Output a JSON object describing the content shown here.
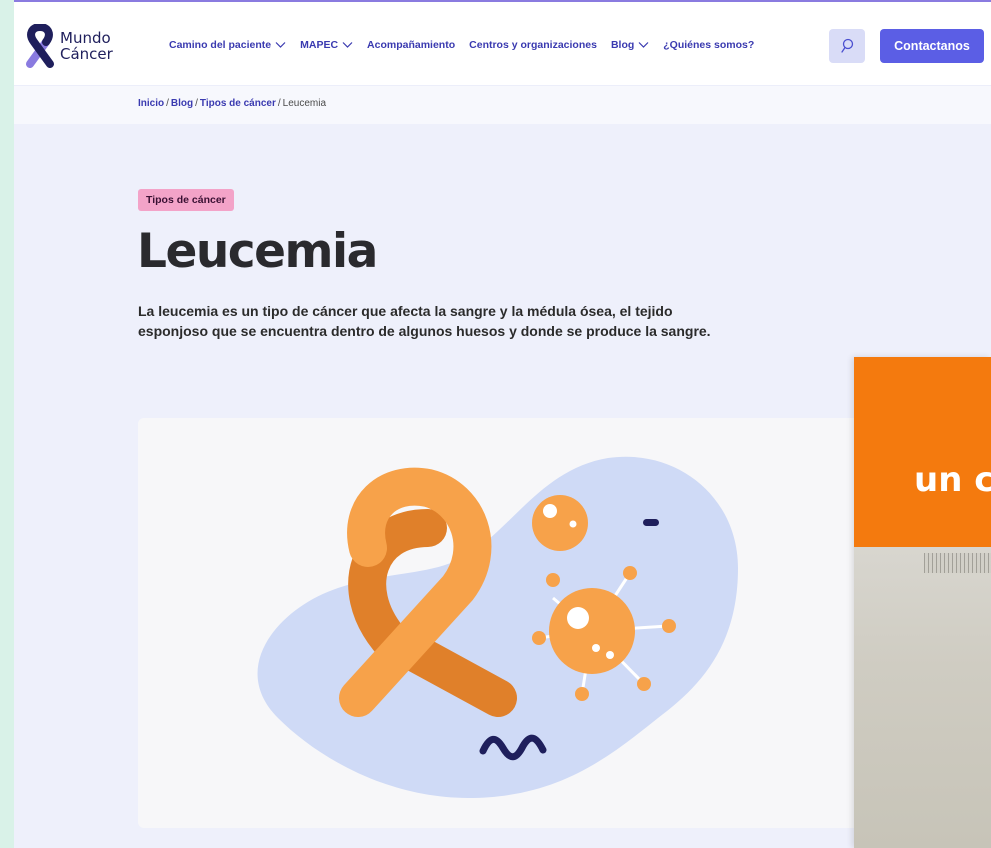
{
  "brand": {
    "name_line1": "Mundo",
    "name_line2": "Cáncer",
    "colors": {
      "primary": "#5b5ee5",
      "navy": "#1f1f5c",
      "accent_orange": "#f47a0e",
      "tag_pink": "#f3a3c8"
    }
  },
  "nav": {
    "items": [
      {
        "label": "Camino del paciente",
        "has_dropdown": true
      },
      {
        "label": "MAPEC",
        "has_dropdown": true
      },
      {
        "label": "Acompañamiento",
        "has_dropdown": false
      },
      {
        "label": "Centros y organizaciones",
        "has_dropdown": false
      },
      {
        "label": "Blog",
        "has_dropdown": true
      },
      {
        "label": "¿Quiénes somos?",
        "has_dropdown": false
      }
    ],
    "search_icon": "search-icon",
    "cta_label": "Contactanos"
  },
  "breadcrumb": {
    "items": [
      "Inicio",
      "Blog",
      "Tipos de cáncer"
    ],
    "current": "Leucemia",
    "separator": "/"
  },
  "article": {
    "tag": "Tipos de cáncer",
    "title": "Leucemia",
    "lead": "La leucemia es un tipo de cáncer que afecta la sangre y la médula ósea, el tejido esponjoso que se encuentra dentro de algunos huesos y donde se produce la sangre."
  },
  "popup": {
    "banner_text": "un c"
  }
}
